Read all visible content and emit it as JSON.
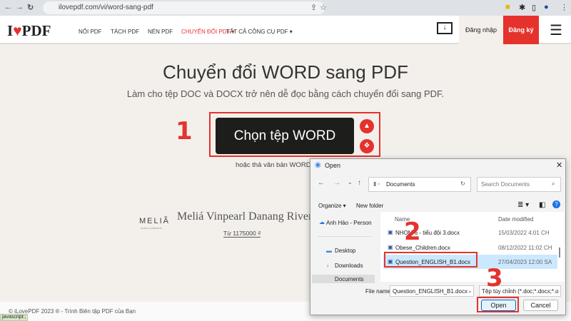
{
  "browser": {
    "url": "ilovepdf.com/vi/word-sang-pdf",
    "status": "javascript:;"
  },
  "site": {
    "logo": "I♥PDF",
    "nav": [
      "NỐI PDF",
      "TÁCH PDF",
      "NÉN PDF",
      "CHUYỂN ĐỔI PDF ▾",
      "TẤT CẢ CÔNG CỤ PDF ▾"
    ],
    "login": "Đăng nhập",
    "signup": "Đăng ký",
    "accent": "#e5322d"
  },
  "main": {
    "title": "Chuyển đổi WORD sang PDF",
    "subtitle": "Làm cho tệp DOC và DOCX trở nên dễ đọc bằng cách chuyển đổi sang PDF.",
    "select_button": "Chọn tệp WORD",
    "drop_hint": "hoặc thả văn bản WORD"
  },
  "ad": {
    "brand": "MELIÃ",
    "brand_sub": "HOTELS & RESORTS",
    "title": "Meliá Vinpearl Danang Riverfront",
    "price": "Từ 1175000 ₫"
  },
  "footer": {
    "text": "© iLovePDF 2023 ® - Trình Biên tập PDF của Bạn"
  },
  "steps": [
    "1",
    "2",
    "3"
  ],
  "dialog": {
    "title": "Open",
    "path": "Documents",
    "search_placeholder": "Search Documents",
    "organize": "Organize ▾",
    "new_folder": "New folder",
    "sidebar": [
      "Anh Hảo - Person",
      "Desktop",
      "Downloads",
      "Documents"
    ],
    "columns": [
      "Name",
      "Date modified"
    ],
    "files": [
      {
        "name": "NHOM 6 - tiểu đội 3.docx",
        "date": "15/03/2022 4:01 CH"
      },
      {
        "name": "Obese_Children.docx",
        "date": "08/12/2022 11:02 CH"
      },
      {
        "name": "Question_ENGLISH_B1.docx",
        "date": "27/04/2023 12:00 SA",
        "selected": true
      }
    ],
    "file_name_label": "File name:",
    "file_name": "Question_ENGLISH_B1.docx",
    "filter": "Tệp tùy chỉnh (*.doc;*.docx;*.o",
    "open": "Open",
    "cancel": "Cancel"
  }
}
